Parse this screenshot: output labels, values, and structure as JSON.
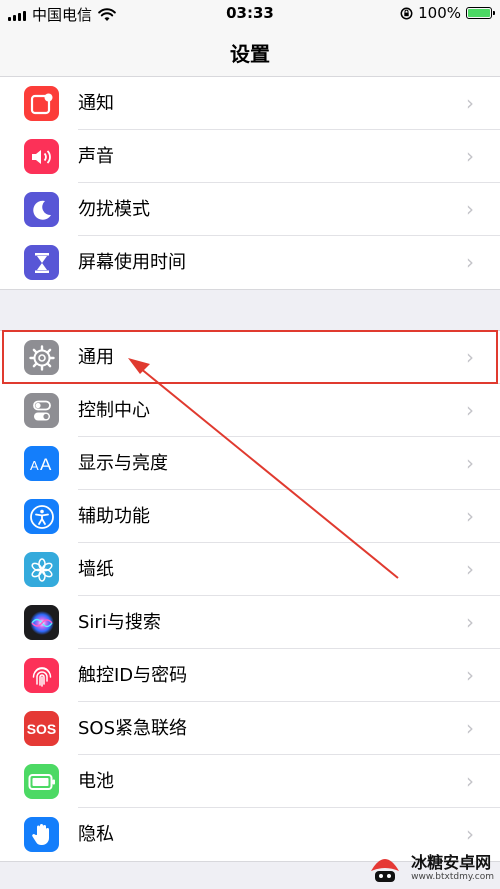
{
  "status_bar": {
    "carrier": "中国电信",
    "time": "03:33",
    "battery_text": "100%",
    "battery_level": 1.0
  },
  "nav": {
    "title": "设置"
  },
  "groups": [
    {
      "items": [
        {
          "label": "通知",
          "icon": "notification-icon",
          "color": "#fc3d39"
        },
        {
          "label": "声音",
          "icon": "sound-icon",
          "color": "#fc3158"
        },
        {
          "label": "勿扰模式",
          "icon": "moon-icon",
          "color": "#5856d6"
        },
        {
          "label": "屏幕使用时间",
          "icon": "hourglass-icon",
          "color": "#5856d6"
        }
      ]
    },
    {
      "items": [
        {
          "label": "通用",
          "icon": "gear-icon",
          "color": "#8e8e93"
        },
        {
          "label": "控制中心",
          "icon": "toggles-icon",
          "color": "#8e8e93"
        },
        {
          "label": "显示与亮度",
          "icon": "text-size-icon",
          "color": "#147efb"
        },
        {
          "label": "辅助功能",
          "icon": "accessibility-icon",
          "color": "#147efb"
        },
        {
          "label": "墙纸",
          "icon": "flower-icon",
          "color": "#34aadc"
        },
        {
          "label": "Siri与搜索",
          "icon": "siri-icon",
          "color": "#1c1c1e"
        },
        {
          "label": "触控ID与密码",
          "icon": "fingerprint-icon",
          "color": "#fc3158"
        },
        {
          "label": "SOS紧急联络",
          "icon": "sos-icon",
          "color": "#e53935",
          "icon_text": "SOS"
        },
        {
          "label": "电池",
          "icon": "battery-icon",
          "color": "#4cd964"
        },
        {
          "label": "隐私",
          "icon": "hand-icon",
          "color": "#147efb"
        }
      ]
    }
  ],
  "annotation": {
    "highlight_color": "#e03a2f"
  },
  "watermark": {
    "name": "冰糖安卓网",
    "url": "www.btxtdmy.com"
  }
}
